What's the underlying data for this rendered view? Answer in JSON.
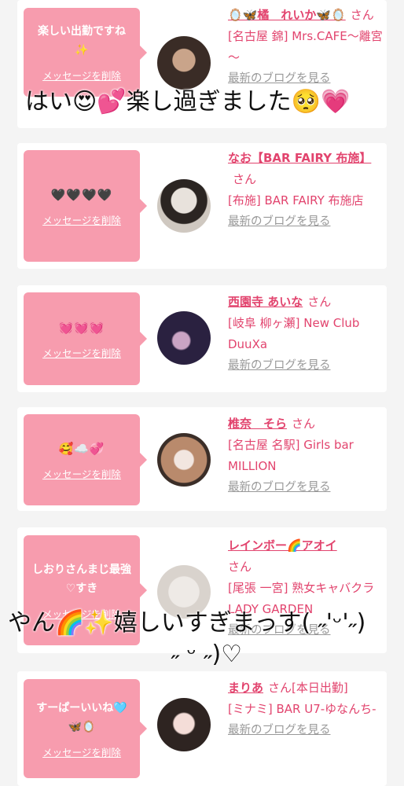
{
  "delete_label": "メッセージを削除",
  "blog_label": "最新のブログを見る",
  "san_label": "さん",
  "colors": {
    "bubble": "#f79cae",
    "accent": "#e2446e",
    "muted": "#999999"
  },
  "cards": [
    {
      "message": "楽しい出勤ですね✨",
      "name": "🪞🦋橘　れいか🦋🪞",
      "shop": "[名古屋 錦] Mrs.CAFE～離宮～",
      "tag": ""
    },
    {
      "message": "🖤🖤🖤🖤",
      "name": "なお【BAR FAIRY 布施】",
      "shop": "[布施] BAR FAIRY 布施店",
      "tag": ""
    },
    {
      "message": "💓💓💓",
      "name": "西園寺 あいな",
      "shop": "[岐阜 柳ヶ瀬] New Club DuuXa",
      "tag": ""
    },
    {
      "message": "🥰☁️💞",
      "name": "椎奈　そら",
      "shop": "[名古屋 名駅] Girls bar MILLION",
      "tag": ""
    },
    {
      "message": "しおりさんまじ最強♡すき",
      "name": "レインボー🌈アオイ",
      "shop": "[尾張 一宮] 熟女キャバクラ LADY GARDEN",
      "tag": ""
    },
    {
      "message": "すーぱーいいね🩵🦋🪞",
      "name": "まりあ",
      "shop": "[ミナミ] BAR U7-ゆなんち-",
      "tag": "[本日出勤]"
    }
  ],
  "overlays": {
    "top": "はい😍💕楽し過ぎました🥺💗",
    "bottom_line1": "やん🌈✨嬉しいすぎまっす( ˶'ᵕ'˶)",
    "bottom_line2": "˶ ᵕ ˶)♡"
  }
}
